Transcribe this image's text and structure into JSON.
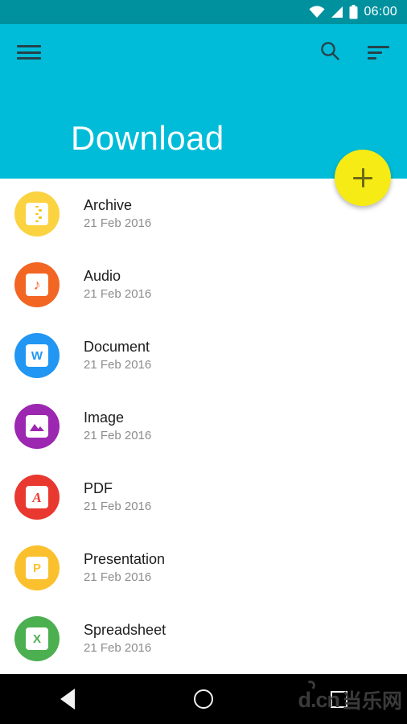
{
  "status_bar": {
    "time": "06:00",
    "icons": [
      "wifi-icon",
      "cellular-signal-icon",
      "battery-icon"
    ],
    "background_color": "#00919e"
  },
  "header": {
    "title": "Download",
    "background_color": "#00bcd8",
    "menu_icon": "hamburger-menu-icon",
    "search_icon": "search-icon",
    "sort_icon": "sort-icon"
  },
  "fab": {
    "label": "+",
    "icon": "plus-icon",
    "color": "#f6eb14",
    "icon_color": "#6b6a17"
  },
  "list": {
    "items": [
      {
        "title": "Archive",
        "date": "21 Feb 2016",
        "icon": "archive-zip-icon",
        "color": "#fbd240",
        "glyph": ""
      },
      {
        "title": "Audio",
        "date": "21 Feb 2016",
        "icon": "music-note-icon",
        "color": "#f26522",
        "glyph": "♪"
      },
      {
        "title": "Document",
        "date": "21 Feb 2016",
        "icon": "word-document-icon",
        "color": "#2196f3",
        "glyph": "W"
      },
      {
        "title": "Image",
        "date": "21 Feb 2016",
        "icon": "picture-icon",
        "color": "#9c27b0",
        "glyph": ""
      },
      {
        "title": "PDF",
        "date": "21 Feb 2016",
        "icon": "pdf-icon",
        "color": "#e8382f",
        "glyph": "A"
      },
      {
        "title": "Presentation",
        "date": "21 Feb 2016",
        "icon": "powerpoint-icon",
        "color": "#fbc02d",
        "glyph": "P"
      },
      {
        "title": "Spreadsheet",
        "date": "21 Feb 2016",
        "icon": "excel-icon",
        "color": "#4caf50",
        "glyph": "X"
      }
    ]
  },
  "nav_bar": {
    "back_icon": "back-triangle-icon",
    "home_icon": "home-circle-icon",
    "recents_icon": "recents-square-icon",
    "watermark_latin": "d.cn",
    "watermark_cjk": "当乐网"
  }
}
